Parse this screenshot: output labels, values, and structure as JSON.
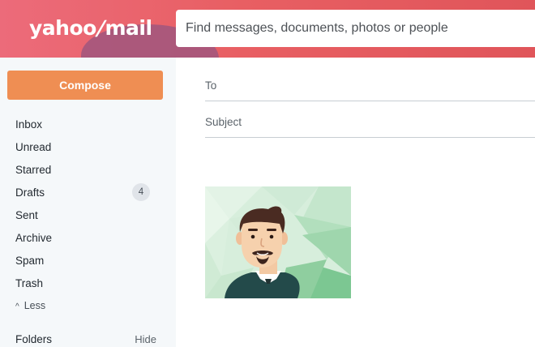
{
  "header": {
    "logo_text": "yahoo!mail",
    "logo_part1": "yahoo",
    "logo_slash": "/",
    "logo_part2": "mail",
    "search_placeholder": "Find messages, documents, photos or people"
  },
  "sidebar": {
    "compose_label": "Compose",
    "items": [
      {
        "label": "Inbox"
      },
      {
        "label": "Unread"
      },
      {
        "label": "Starred"
      },
      {
        "label": "Drafts",
        "count": "4"
      },
      {
        "label": "Sent"
      },
      {
        "label": "Archive"
      },
      {
        "label": "Spam"
      },
      {
        "label": "Trash"
      }
    ],
    "less_label": "Less",
    "folders_label": "Folders",
    "hide_label": "Hide"
  },
  "compose": {
    "to_placeholder": "To",
    "subject_placeholder": "Subject"
  },
  "colors": {
    "header_accent": "#e85f63",
    "compose_button": "#ef8e53",
    "sidebar_bg": "#f5f8fa"
  },
  "icons": {
    "less": "chevron-up-icon",
    "attachment": "avatar-illustration"
  }
}
